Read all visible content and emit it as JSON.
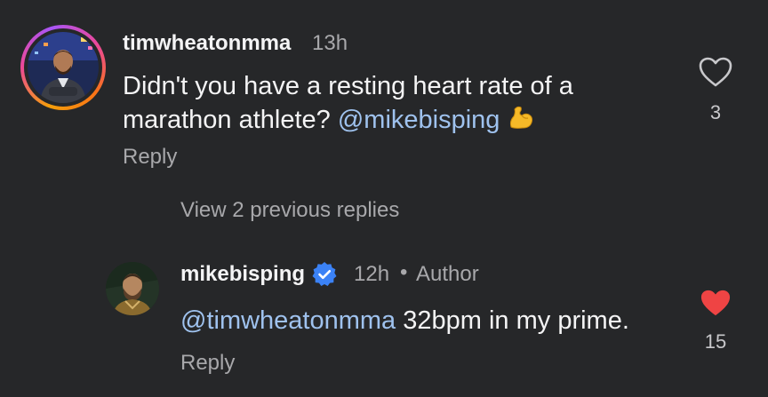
{
  "comment": {
    "username": "timwheatonmma",
    "time": "13h",
    "text_part1": "Didn't you have a resting heart rate of a",
    "text_part2": "marathon athlete?",
    "mention": "@mikebisping",
    "emoji": "flexed-biceps",
    "likes": "3",
    "liked": false,
    "reply_label": "Reply"
  },
  "view_replies_label": "View 2 previous replies",
  "reply": {
    "username": "mikebisping",
    "verified": true,
    "time": "12h",
    "separator": "•",
    "author_label": "Author",
    "mention": "@timwheatonmma",
    "text": "32bpm in my prime.",
    "likes": "15",
    "liked": true,
    "reply_label": "Reply"
  },
  "colors": {
    "background": "#262729",
    "mention": "#9fc2ee",
    "secondary_text": "#a8a8ab",
    "like_active": "#ef4444",
    "verified": "#3b82f6"
  }
}
